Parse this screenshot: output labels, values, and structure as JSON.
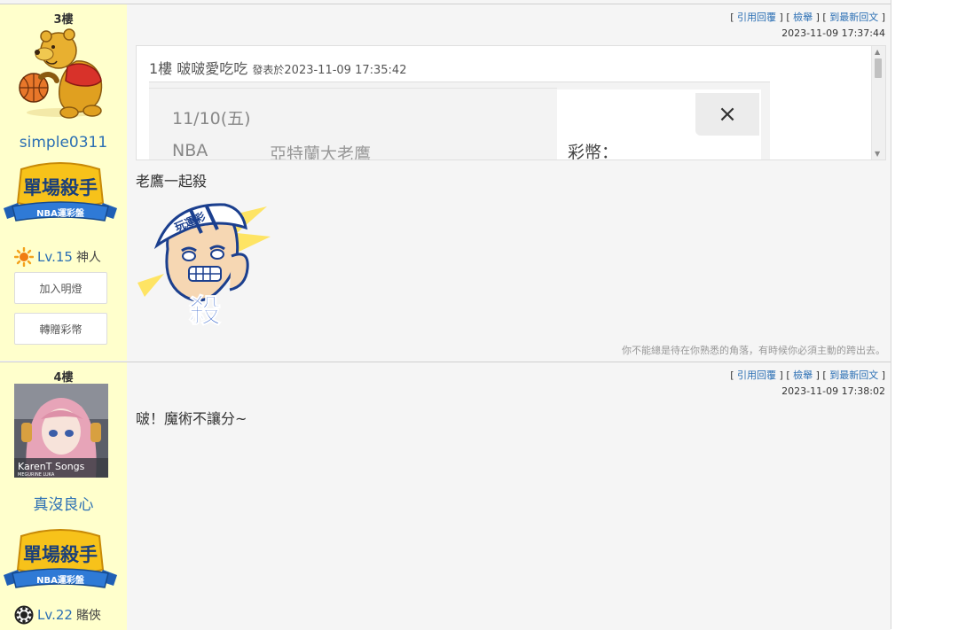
{
  "posts": [
    {
      "floor": "3樓",
      "username": "simple0311",
      "badge": {
        "title": "單場殺手",
        "subtitle": "NBA運彩盤"
      },
      "level": {
        "num": "Lv.15",
        "rank": "神人"
      },
      "buttons": {
        "light": "加入明燈",
        "gift": "轉贈彩幣"
      },
      "actions": {
        "quote": "引用回覆",
        "report": "檢舉",
        "latest": "到最新回文"
      },
      "time": "2023-11-09 17:37:44",
      "quote": {
        "floor": "1樓",
        "author": "啵啵愛吃吃",
        "posted_prefix": "發表於",
        "posted_time": "2023-11-09 17:35:42",
        "shot_date": "11/10(五)",
        "shot_league": "NBA",
        "shot_team": "亞特蘭大老鷹",
        "shot_label": "彩幣：",
        "shot_close": "×"
      },
      "text": "老鷹一起殺",
      "sticker": {
        "cap": "玩運彩",
        "char": "殺"
      },
      "signature": "你不能總是待在你熟悉的角落，有時候你必須主動的跨出去。"
    },
    {
      "floor": "4樓",
      "username": "真沒良心",
      "avatar_caption": {
        "main": "KarenT Songs",
        "sub": "MEGURINE LUKA"
      },
      "badge": {
        "title": "單場殺手",
        "subtitle": "NBA運彩盤"
      },
      "level": {
        "num": "Lv.22",
        "rank": "賭俠"
      },
      "actions": {
        "quote": "引用回覆",
        "report": "檢舉",
        "latest": "到最新回文"
      },
      "time": "2023-11-09 17:38:02",
      "text": "啵！魔術不讓分~"
    }
  ],
  "colors": {
    "link": "#2b6fb4",
    "user_col": "#ffffcc",
    "badge_blue": "#1f5fb5",
    "badge_gold": "#f7c21a"
  }
}
